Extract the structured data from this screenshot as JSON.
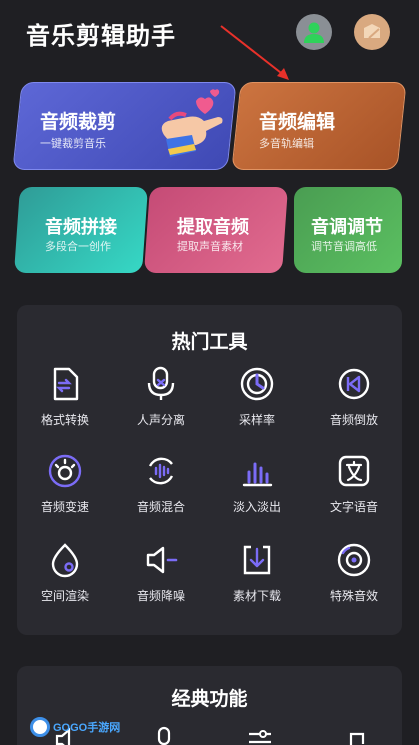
{
  "app": {
    "title": "音乐剪辑助手"
  },
  "header": {
    "user_icon": "user-avatar-icon",
    "skin_icon": "theme-skin-icon"
  },
  "feature_cards": [
    {
      "title": "音频裁剪",
      "subtitle": "一键裁剪音乐",
      "color": "#4a54c4"
    },
    {
      "title": "音频编辑",
      "subtitle": "多音轨编辑",
      "color": "#b8602f"
    },
    {
      "title": "音频拼接",
      "subtitle": "多段合一创作",
      "color": "#33bdb0"
    },
    {
      "title": "提取音频",
      "subtitle": "提取声音素材",
      "color": "#d45a82"
    },
    {
      "title": "音调调节",
      "subtitle": "调节音调高低",
      "color": "#52ae59"
    }
  ],
  "hot_tools": {
    "title": "热门工具",
    "items": [
      {
        "label": "格式转换",
        "icon": "format-convert-icon"
      },
      {
        "label": "人声分离",
        "icon": "vocal-separation-icon"
      },
      {
        "label": "采样率",
        "icon": "sample-rate-icon"
      },
      {
        "label": "音频倒放",
        "icon": "reverse-play-icon"
      },
      {
        "label": "音频变速",
        "icon": "speed-change-icon"
      },
      {
        "label": "音频混合",
        "icon": "audio-mix-icon"
      },
      {
        "label": "淡入淡出",
        "icon": "fade-in-out-icon"
      },
      {
        "label": "文字语音",
        "icon": "text-to-speech-icon"
      },
      {
        "label": "空间渲染",
        "icon": "spatial-render-icon"
      },
      {
        "label": "音频降噪",
        "icon": "noise-reduction-icon"
      },
      {
        "label": "素材下载",
        "icon": "material-download-icon"
      },
      {
        "label": "特殊音效",
        "icon": "special-effect-icon"
      }
    ]
  },
  "classic": {
    "title": "经典功能"
  },
  "watermark": {
    "text": "GOGO手游网"
  },
  "colors": {
    "accent": "#7b6cf6",
    "background": "#1f1f23",
    "panel": "#2a2a30"
  }
}
